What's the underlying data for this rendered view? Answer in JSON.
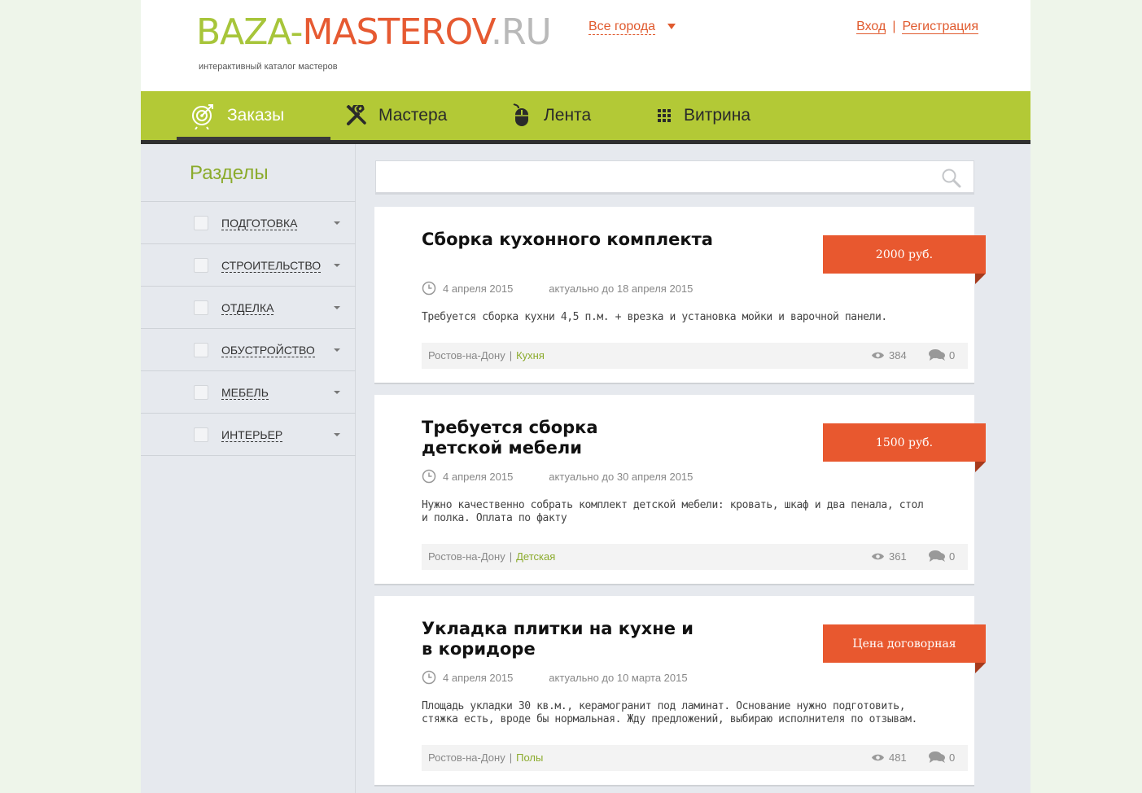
{
  "header": {
    "logo_part1": "BAZA-",
    "logo_part2": "MASTEROV",
    "logo_part3": ".RU",
    "tagline": "интерактивный каталог мастеров",
    "city_select": "Все города",
    "login": "Вход",
    "register": "Регистрация"
  },
  "nav": {
    "items": [
      {
        "label": "Заказы",
        "icon": "target-icon",
        "active": true
      },
      {
        "label": "Мастера",
        "icon": "tools-icon",
        "active": false
      },
      {
        "label": "Лента",
        "icon": "mouse-icon",
        "active": false
      },
      {
        "label": "Витрина",
        "icon": "grid-icon",
        "active": false
      }
    ]
  },
  "sidebar": {
    "title": "Разделы",
    "items": [
      {
        "label": "ПОДГОТОВКА"
      },
      {
        "label": "СТРОИТЕЛЬСТВО"
      },
      {
        "label": "ОТДЕЛКА"
      },
      {
        "label": "ОБУСТРОЙСТВО"
      },
      {
        "label": "МЕБЕЛЬ"
      },
      {
        "label": "ИНТЕРЬЕР"
      }
    ]
  },
  "search": {
    "placeholder": ""
  },
  "orders": [
    {
      "title": "Сборка кухонного комплекта",
      "price": "2000 руб.",
      "date": "4 апреля 2015",
      "until": "актуально до 18 апреля 2015",
      "description": "Требуется сборка кухни 4,5 п.м. + врезка и установка мойки и варочной панели.",
      "city": "Ростов-на-Дону",
      "category": "Кухня",
      "views": "384",
      "comments": "0"
    },
    {
      "title": "Требуется сборка детской мебели",
      "price": "1500 руб.",
      "date": "4 апреля 2015",
      "until": "актуально до 30 апреля 2015",
      "description": "Нужно качественно собрать комплект детской мебели: кровать, шкаф и два пенала, стол и полка. Оплата по факту",
      "city": "Ростов-на-Дону",
      "category": "Детская",
      "views": "361",
      "comments": "0"
    },
    {
      "title": "Укладка плитки на кухне и в коридоре",
      "price": "Цена договорная",
      "date": "4 апреля 2015",
      "until": "актуально до 10 марта 2015",
      "description": "Площадь укладки 30 кв.м., керамогранит под ламинат. Основание нужно подготовить, стяжка есть, вроде бы нормальная. Жду предложений, выбираю исполнителя по отзывам.",
      "city": "Ростов-на-Дону",
      "category": "Полы",
      "views": "481",
      "comments": "0"
    }
  ],
  "colors": {
    "brand_green": "#b3c936",
    "accent_orange": "#e8582f",
    "logo_gray": "#b9b9b9"
  }
}
